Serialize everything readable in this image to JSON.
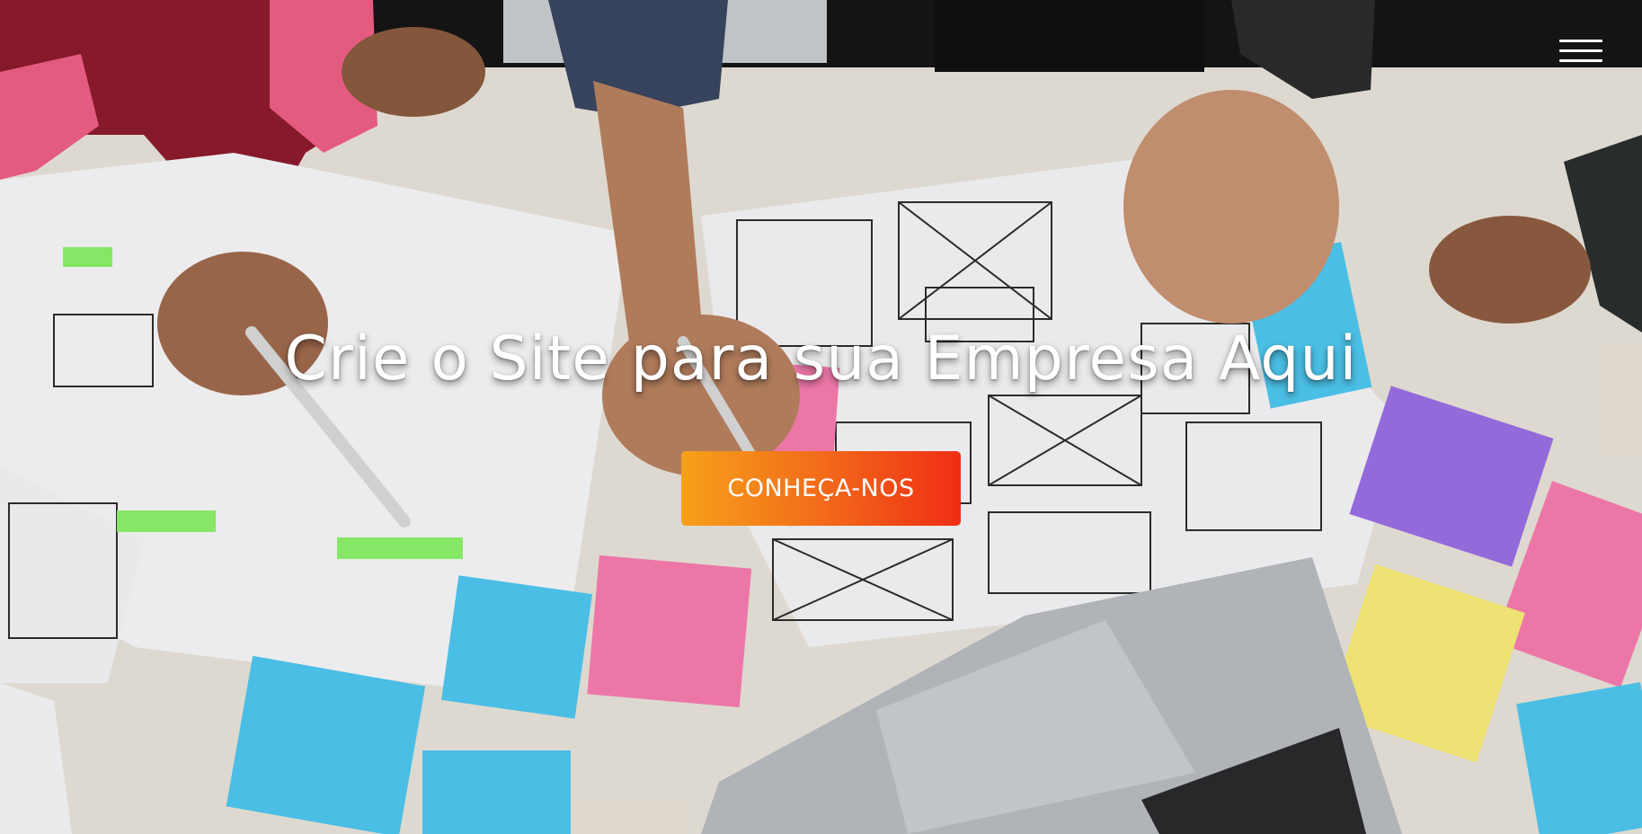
{
  "header": {
    "menu_icon": "hamburger-menu-icon"
  },
  "hero": {
    "title": "Crie o Site para sua Empresa Aqui",
    "cta_label": "CONHEÇA-NOS",
    "background_image": "team-planning-wireframes-photo"
  },
  "colors": {
    "cta_gradient_start": "#f6a11a",
    "cta_gradient_end": "#ef2d14",
    "title_text": "#ffffff"
  }
}
